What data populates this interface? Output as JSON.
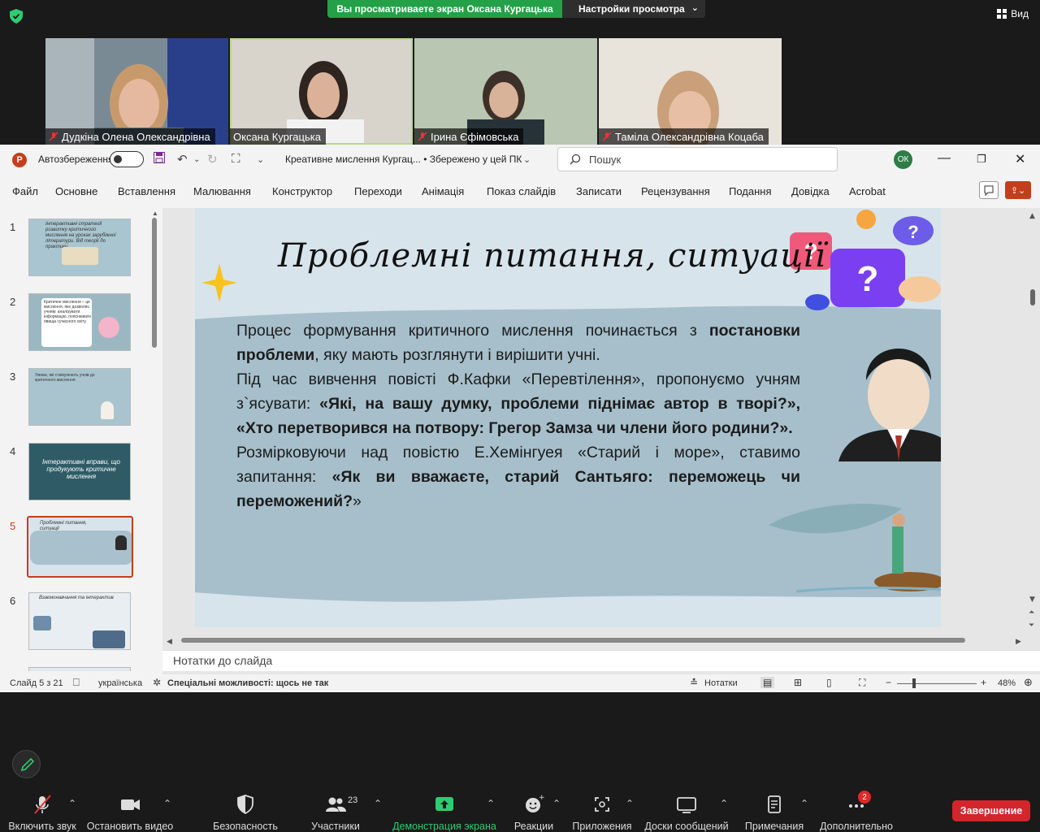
{
  "zoom": {
    "share_banner": "Вы просматриваете экран Оксана Кургацька",
    "view_settings": "Настройки просмотра",
    "view_button": "Вид",
    "participants": [
      {
        "name": "Дудкіна Олена Олександрівна",
        "muted": true
      },
      {
        "name": "Оксана Кургацька",
        "muted": false
      },
      {
        "name": "Ірина Єфімовська",
        "muted": true
      },
      {
        "name": "Таміла Олександрівна Коцаба",
        "muted": true
      }
    ],
    "toolbar": {
      "mute": "Включить звук",
      "video": "Остановить видео",
      "security": "Безопасность",
      "participants": "Участники",
      "participants_count": "23",
      "share": "Демонстрация экрана",
      "reactions": "Реакции",
      "apps": "Приложения",
      "whiteboards": "Доски сообщений",
      "notes": "Примечания",
      "more": "Дополнительно",
      "more_badge": "2",
      "end": "Завершение"
    }
  },
  "ppt": {
    "logo": "P",
    "autosave_label": "Автозбереження",
    "doc_title": "Креативне мислення Кургац...  •  Збережено у цей ПК",
    "search_placeholder": "Пошук",
    "user_initials": "ОК",
    "menu": [
      "Файл",
      "Основне",
      "Вставлення",
      "Малювання",
      "Конструктор",
      "Переходи",
      "Анімація",
      "Показ слайдів",
      "Записати",
      "Рецензування",
      "Подання",
      "Довідка",
      "Acrobat"
    ],
    "thumbnails": [
      {
        "num": "1",
        "text": "Інтерактивні стратегії розвитку критичного мислення на уроках зарубіжної літератури. Від теорії до практики"
      },
      {
        "num": "2",
        "text": "Критичне мислення – це мислення, яке дозволяє учням: аналізувати інформацію, пояснювати явища сучасного світу."
      },
      {
        "num": "3",
        "text": "Умови, які стимулюють учнів до критичного мислення"
      },
      {
        "num": "4",
        "text": "Інтерактивні вправи, що продукують критичне мислення"
      },
      {
        "num": "5",
        "text": "Проблемні питання, ситуації"
      },
      {
        "num": "6",
        "text": "Взаємонавчання та інтерактив"
      },
      {
        "num": "7",
        "text": ""
      }
    ],
    "slide": {
      "title": "Проблемні питання, ситуації",
      "p1_a": "Процес формування критичного мислення починається з ",
      "p1_b": "постановки проблеми",
      "p1_c": ", яку мають розглянути і вирішити учні.",
      "p2_a": " Під час вивчення повісті Ф.Кафки «Перевтілення», пропонуємо учням з`ясувати: ",
      "p2_b": "«Які, на вашу думку, проблеми піднімає автор в творі?», «Хто перетворився на потвору: Грегор Замза чи члени його родини?».",
      "p3_a": " Розмірковуючи над повістю Е.Хемінгуея «Старий і море», ставимо запитання: ",
      "p3_b": "«Як ви вважаєте, старий Сантьяго: переможець чи переможений?",
      "p3_c": "»"
    },
    "notes_placeholder": "Нотатки до слайда",
    "status": {
      "slide_info": "Слайд 5 з 21",
      "language": "українська",
      "accessibility": "Спеціальні можливості: щось не так",
      "notes": "Нотатки",
      "zoom": "48%"
    }
  }
}
